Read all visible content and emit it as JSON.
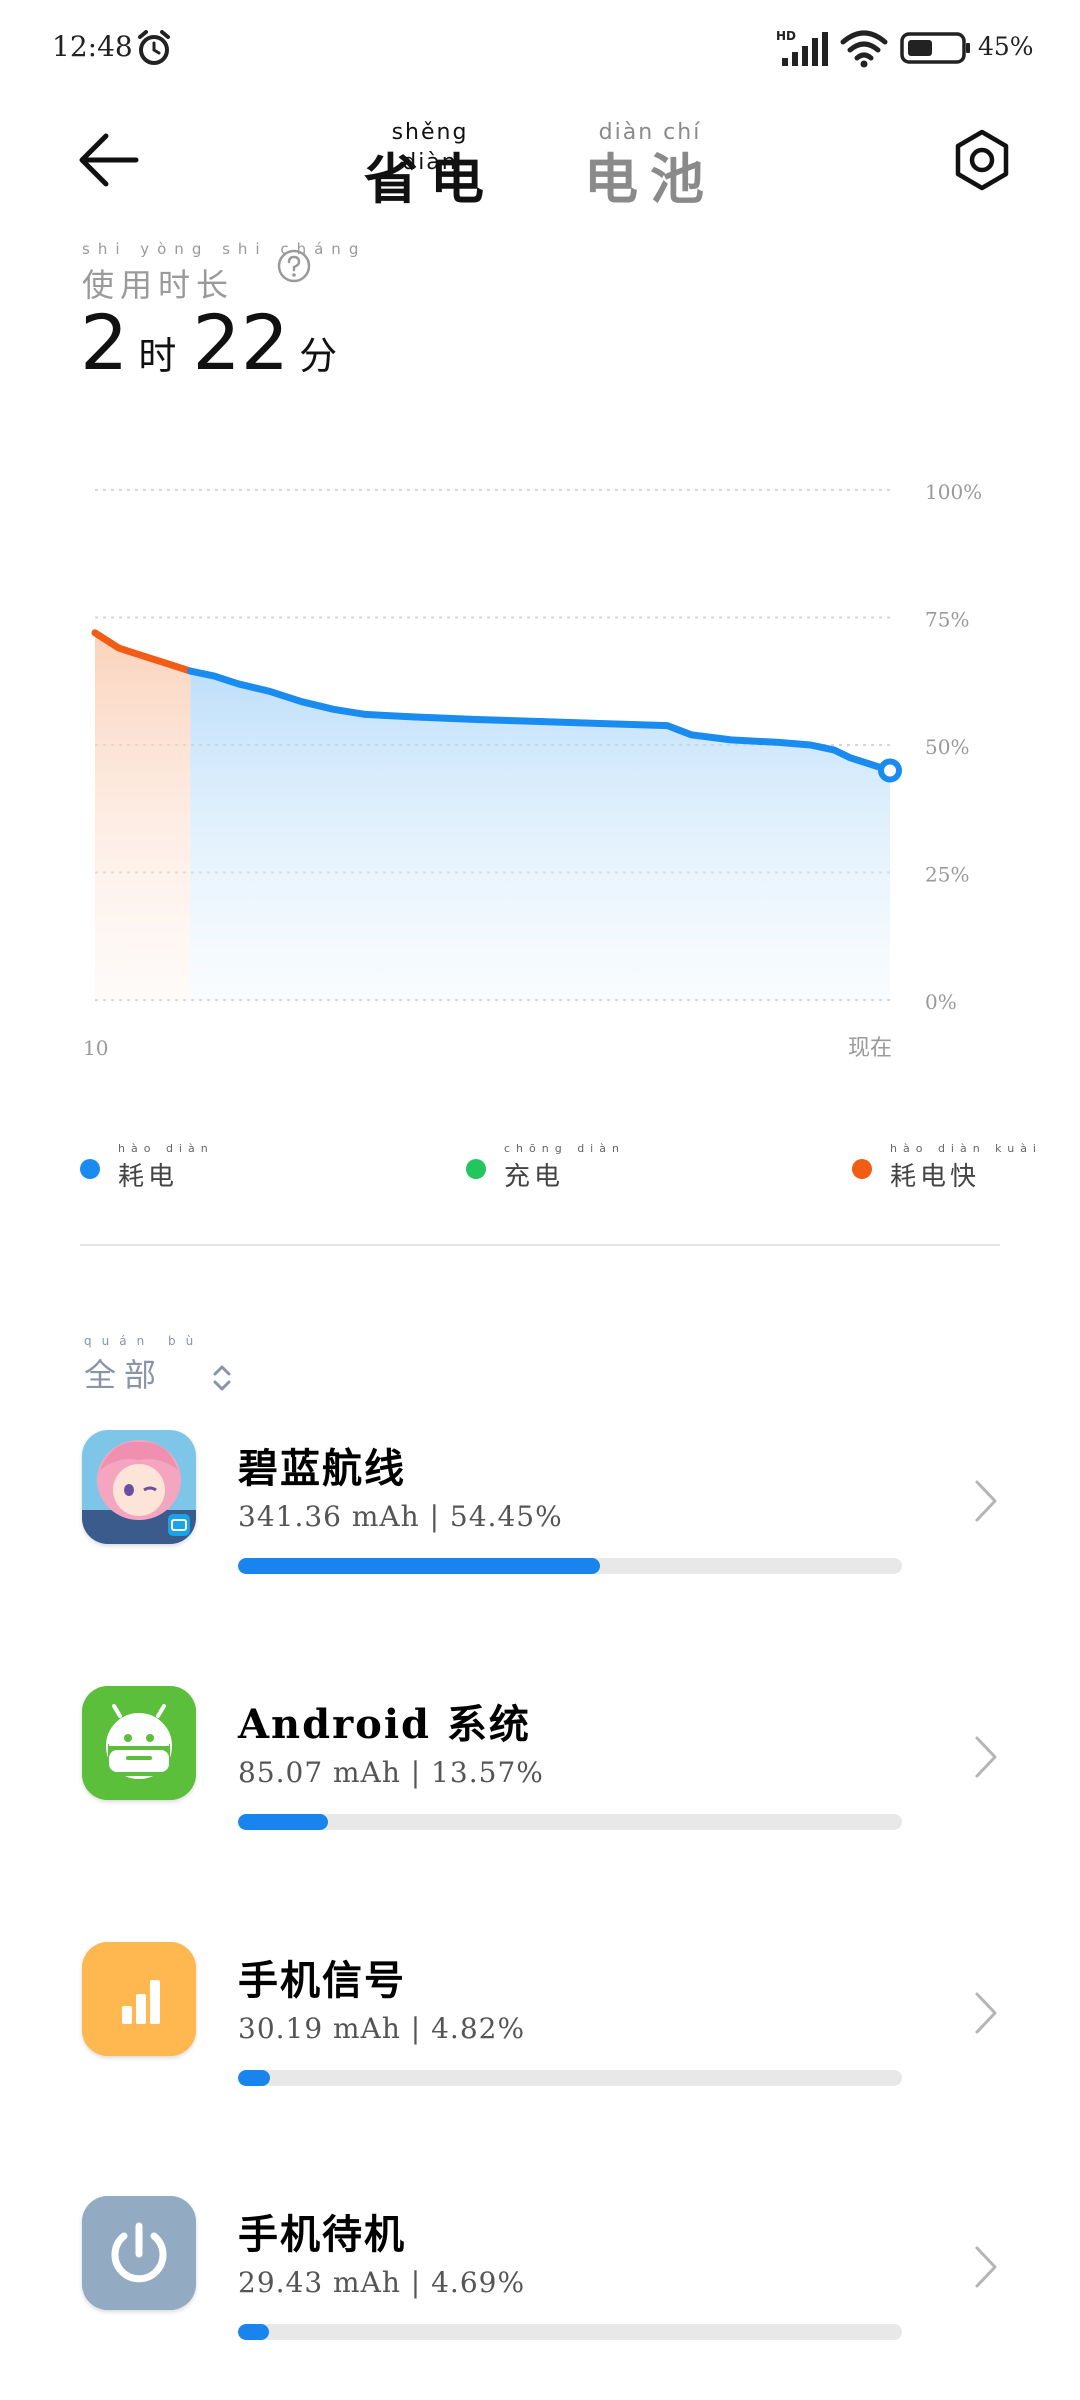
{
  "status": {
    "time": "12:48",
    "battery": "45%"
  },
  "header": {
    "tab_power_save": {
      "pinyin": "shěng diàn",
      "label": "省电"
    },
    "tab_battery": {
      "pinyin": "diàn chí",
      "label": "电池"
    }
  },
  "usage": {
    "label_pinyin": "shi yòng shi cháng",
    "label": "使用时长",
    "hours": "2",
    "hours_unit": "时",
    "minutes": "22",
    "minutes_unit": "分"
  },
  "chart_data": {
    "type": "area",
    "x_start_label": "10",
    "x_end_label": "现在",
    "ytick_labels": [
      "100%",
      "75%",
      "50%",
      "25%",
      "0%"
    ],
    "ylim": [
      0,
      100
    ],
    "grid": true,
    "points": [
      [
        0,
        72
      ],
      [
        3,
        69
      ],
      [
        6,
        67.5
      ],
      [
        9,
        66
      ],
      [
        12,
        64.5
      ],
      [
        15,
        63.5
      ],
      [
        18,
        62
      ],
      [
        22,
        60.5
      ],
      [
        26,
        58.5
      ],
      [
        30,
        57
      ],
      [
        34,
        56
      ],
      [
        40,
        55.5
      ],
      [
        48,
        55
      ],
      [
        56,
        54.6
      ],
      [
        64,
        54.2
      ],
      [
        68,
        54
      ],
      [
        72,
        53.8
      ],
      [
        75,
        52
      ],
      [
        80,
        51
      ],
      [
        86,
        50.5
      ],
      [
        90,
        50
      ],
      [
        93,
        49
      ],
      [
        95,
        47.5
      ],
      [
        100,
        45
      ]
    ],
    "fast_drain_until": 12,
    "colors": {
      "drain": "#1a8cf0",
      "fast_drain": "#f25c14",
      "charge": "#22c55e"
    }
  },
  "legend": [
    {
      "pinyin": "hào diàn",
      "label": "耗电",
      "color": "#1a8cf0"
    },
    {
      "pinyin": "chōng diàn",
      "label": "充电",
      "color": "#22c55e"
    },
    {
      "pinyin": "hào diàn kuài",
      "label": "耗电快",
      "color": "#f25c14"
    }
  ],
  "filter": {
    "pinyin": "quán bù",
    "label": "全部"
  },
  "apps": [
    {
      "name": "碧蓝航线",
      "stat": "341.36 mAh | 54.45%",
      "percent": 54.45,
      "icon": "azur-lane-app-icon"
    },
    {
      "name": "Android 系统",
      "stat": "85.07 mAh | 13.57%",
      "percent": 13.57,
      "icon": "android-system-icon"
    },
    {
      "name": "手机信号",
      "stat": "30.19 mAh | 4.82%",
      "percent": 4.82,
      "icon": "signal-bars-icon"
    },
    {
      "name": "手机待机",
      "stat": "29.43 mAh | 4.69%",
      "percent": 4.69,
      "icon": "power-icon"
    }
  ]
}
